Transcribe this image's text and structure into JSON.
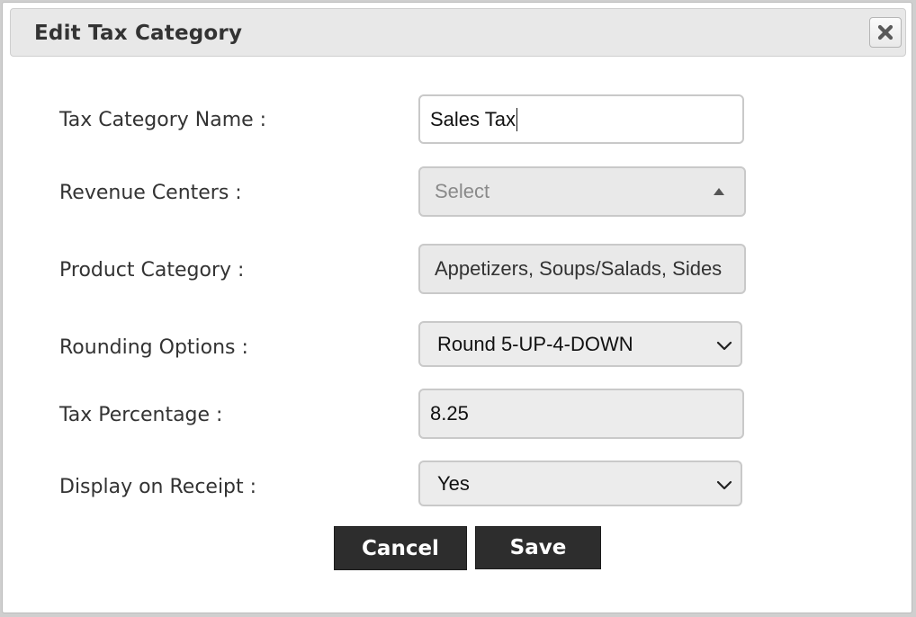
{
  "dialog": {
    "title": "Edit Tax Category",
    "close_icon": "close-icon"
  },
  "form": {
    "tax_category_name": {
      "label": "Tax Category Name :",
      "value": "Sales Tax"
    },
    "revenue_centers": {
      "label": "Revenue Centers :",
      "placeholder": "Select",
      "icon": "caret-up-icon"
    },
    "product_category": {
      "label": "Product Category :",
      "value": "Appetizers, Soups/Salads, Sides"
    },
    "rounding_options": {
      "label": "Rounding Options :",
      "value": "Round 5-UP-4-DOWN",
      "icon": "chevron-down-icon"
    },
    "tax_percentage": {
      "label": "Tax Percentage :",
      "value": "8.25"
    },
    "display_on_receipt": {
      "label": "Display on Receipt :",
      "value": "Yes",
      "icon": "chevron-down-icon"
    }
  },
  "actions": {
    "cancel_label": "Cancel",
    "save_label": "Save"
  },
  "colors": {
    "button_bg": "#2d2d2d",
    "titlebar_bg": "#e8e8e8",
    "field_bg": "#ececec"
  }
}
